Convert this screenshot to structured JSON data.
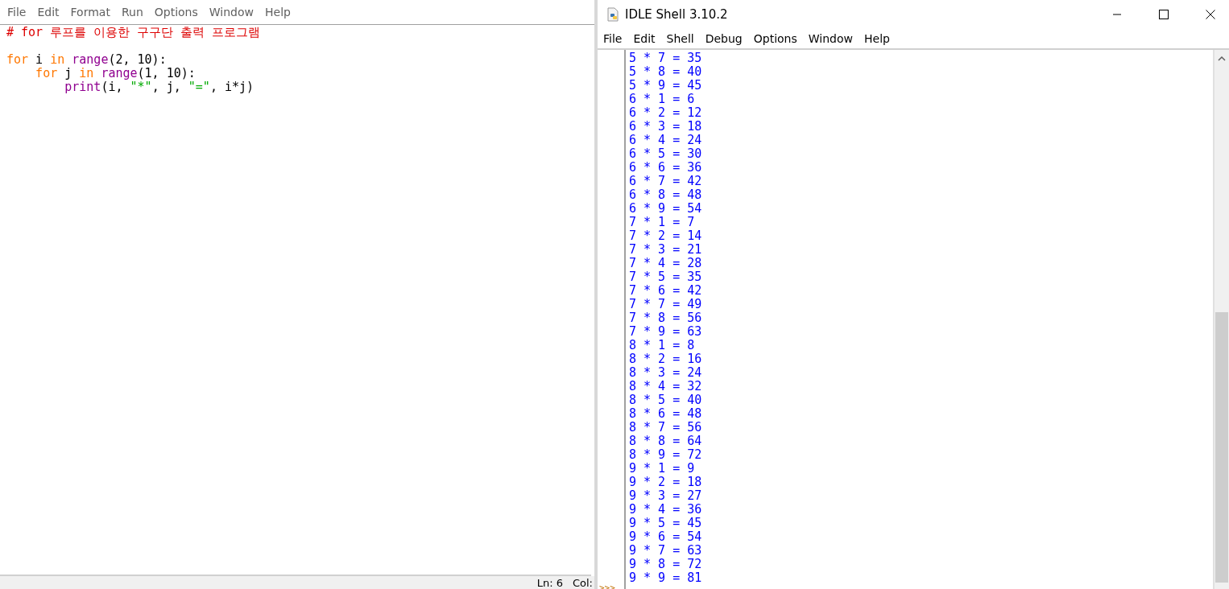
{
  "editor": {
    "menu": [
      "File",
      "Edit",
      "Format",
      "Run",
      "Options",
      "Window",
      "Help"
    ],
    "code_lines": [
      {
        "kind": "code",
        "segments": [
          {
            "text": "# for 루프를 이용한 구구단 출력 프로그램",
            "kind": "comment"
          }
        ]
      },
      {
        "kind": "blank"
      },
      {
        "kind": "code",
        "segments": [
          {
            "text": "for",
            "kind": "keyword"
          },
          {
            "text": " i ",
            "kind": "plain"
          },
          {
            "text": "in",
            "kind": "keyword"
          },
          {
            "text": " range",
            "kind": "builtin"
          },
          {
            "text": "(2, 10):",
            "kind": "plain"
          }
        ]
      },
      {
        "kind": "code",
        "segments": [
          {
            "text": "    for",
            "kind": "keyword"
          },
          {
            "text": " j ",
            "kind": "plain"
          },
          {
            "text": "in",
            "kind": "keyword"
          },
          {
            "text": " range",
            "kind": "builtin"
          },
          {
            "text": "(1, 10):",
            "kind": "plain"
          }
        ]
      },
      {
        "kind": "code",
        "segments": [
          {
            "text": "        print",
            "kind": "builtin"
          },
          {
            "text": "(i, ",
            "kind": "plain"
          },
          {
            "text": "\"*\"",
            "kind": "string"
          },
          {
            "text": ", j, ",
            "kind": "plain"
          },
          {
            "text": "\"=\"",
            "kind": "string"
          },
          {
            "text": ", i*j)",
            "kind": "plain"
          }
        ]
      }
    ],
    "status_bar": {
      "line": "Ln: 6",
      "column": "Col:"
    }
  },
  "shell": {
    "window": {
      "title": "IDLE Shell 3.10.2"
    },
    "menu": [
      "File",
      "Edit",
      "Shell",
      "Debug",
      "Options",
      "Window",
      "Help"
    ],
    "prompt": ">>>",
    "output_lines": [
      "5 * 7 = 35",
      "5 * 8 = 40",
      "5 * 9 = 45",
      "6 * 1 = 6",
      "6 * 2 = 12",
      "6 * 3 = 18",
      "6 * 4 = 24",
      "6 * 5 = 30",
      "6 * 6 = 36",
      "6 * 7 = 42",
      "6 * 8 = 48",
      "6 * 9 = 54",
      "7 * 1 = 7",
      "7 * 2 = 14",
      "7 * 3 = 21",
      "7 * 4 = 28",
      "7 * 5 = 35",
      "7 * 6 = 42",
      "7 * 7 = 49",
      "7 * 8 = 56",
      "7 * 9 = 63",
      "8 * 1 = 8",
      "8 * 2 = 16",
      "8 * 3 = 24",
      "8 * 4 = 32",
      "8 * 5 = 40",
      "8 * 6 = 48",
      "8 * 7 = 56",
      "8 * 8 = 64",
      "8 * 9 = 72",
      "9 * 1 = 9",
      "9 * 2 = 18",
      "9 * 3 = 27",
      "9 * 4 = 36",
      "9 * 5 = 45",
      "9 * 6 = 54",
      "9 * 7 = 63",
      "9 * 8 = 72",
      "9 * 9 = 81"
    ]
  }
}
